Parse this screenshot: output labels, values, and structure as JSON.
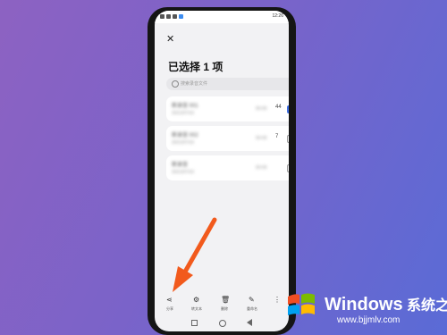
{
  "status_bar": {
    "time": "12:26"
  },
  "header": {
    "close_glyph": "✕",
    "title": "已选择 1 项"
  },
  "search": {
    "placeholder": "搜索录音文件"
  },
  "recordings": [
    {
      "name": "新录音 001",
      "meta": "2021/07/10",
      "date": "00:00",
      "duration": "44",
      "checked": true
    },
    {
      "name": "新录音 002",
      "meta": "2021/07/10",
      "date": "00:00",
      "duration": "7",
      "checked": false
    },
    {
      "name": "新录音",
      "meta": "2021/07/10",
      "date": "00:00",
      "duration": "",
      "checked": false
    }
  ],
  "toolbar": [
    {
      "icon": "share-icon",
      "glyph": "⋖",
      "label": "分享"
    },
    {
      "icon": "convert-text-icon",
      "glyph": "⚙",
      "label": "转文本"
    },
    {
      "icon": "delete-icon",
      "glyph": "🗑",
      "label": "删除"
    },
    {
      "icon": "rename-icon",
      "glyph": "✎",
      "label": "重命名"
    },
    {
      "icon": "more-icon",
      "glyph": "⋮",
      "label": ""
    }
  ],
  "colors": {
    "accent": "#3d6fe3",
    "arrow": "#f25a1c"
  },
  "watermark": {
    "title": "Windows",
    "title_cn": " 系统之家",
    "url": "www.bjjmlv.com"
  }
}
